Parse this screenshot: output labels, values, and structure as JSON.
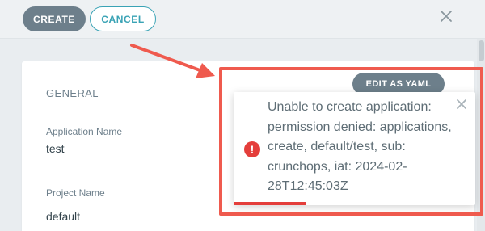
{
  "toolbar": {
    "create_label": "CREATE",
    "cancel_label": "CANCEL"
  },
  "form": {
    "section_title": "GENERAL",
    "edit_yaml_label": "EDIT AS YAML",
    "application_name": {
      "label": "Application Name",
      "value": "test"
    },
    "project_name": {
      "label": "Project Name",
      "value": "default"
    }
  },
  "toast": {
    "severity": "error",
    "message": "Unable to create application: permission denied: applications, create, default/test, sub: crunchops, iat: 2024-02-28T12:45:03Z",
    "icon": "exclamation-icon",
    "progress_fraction": 0.3
  },
  "colors": {
    "primary_button": "#6d7f8b",
    "accent": "#3aa3b5",
    "error": "#e43e3b",
    "annotation": "#ef5a4e"
  }
}
